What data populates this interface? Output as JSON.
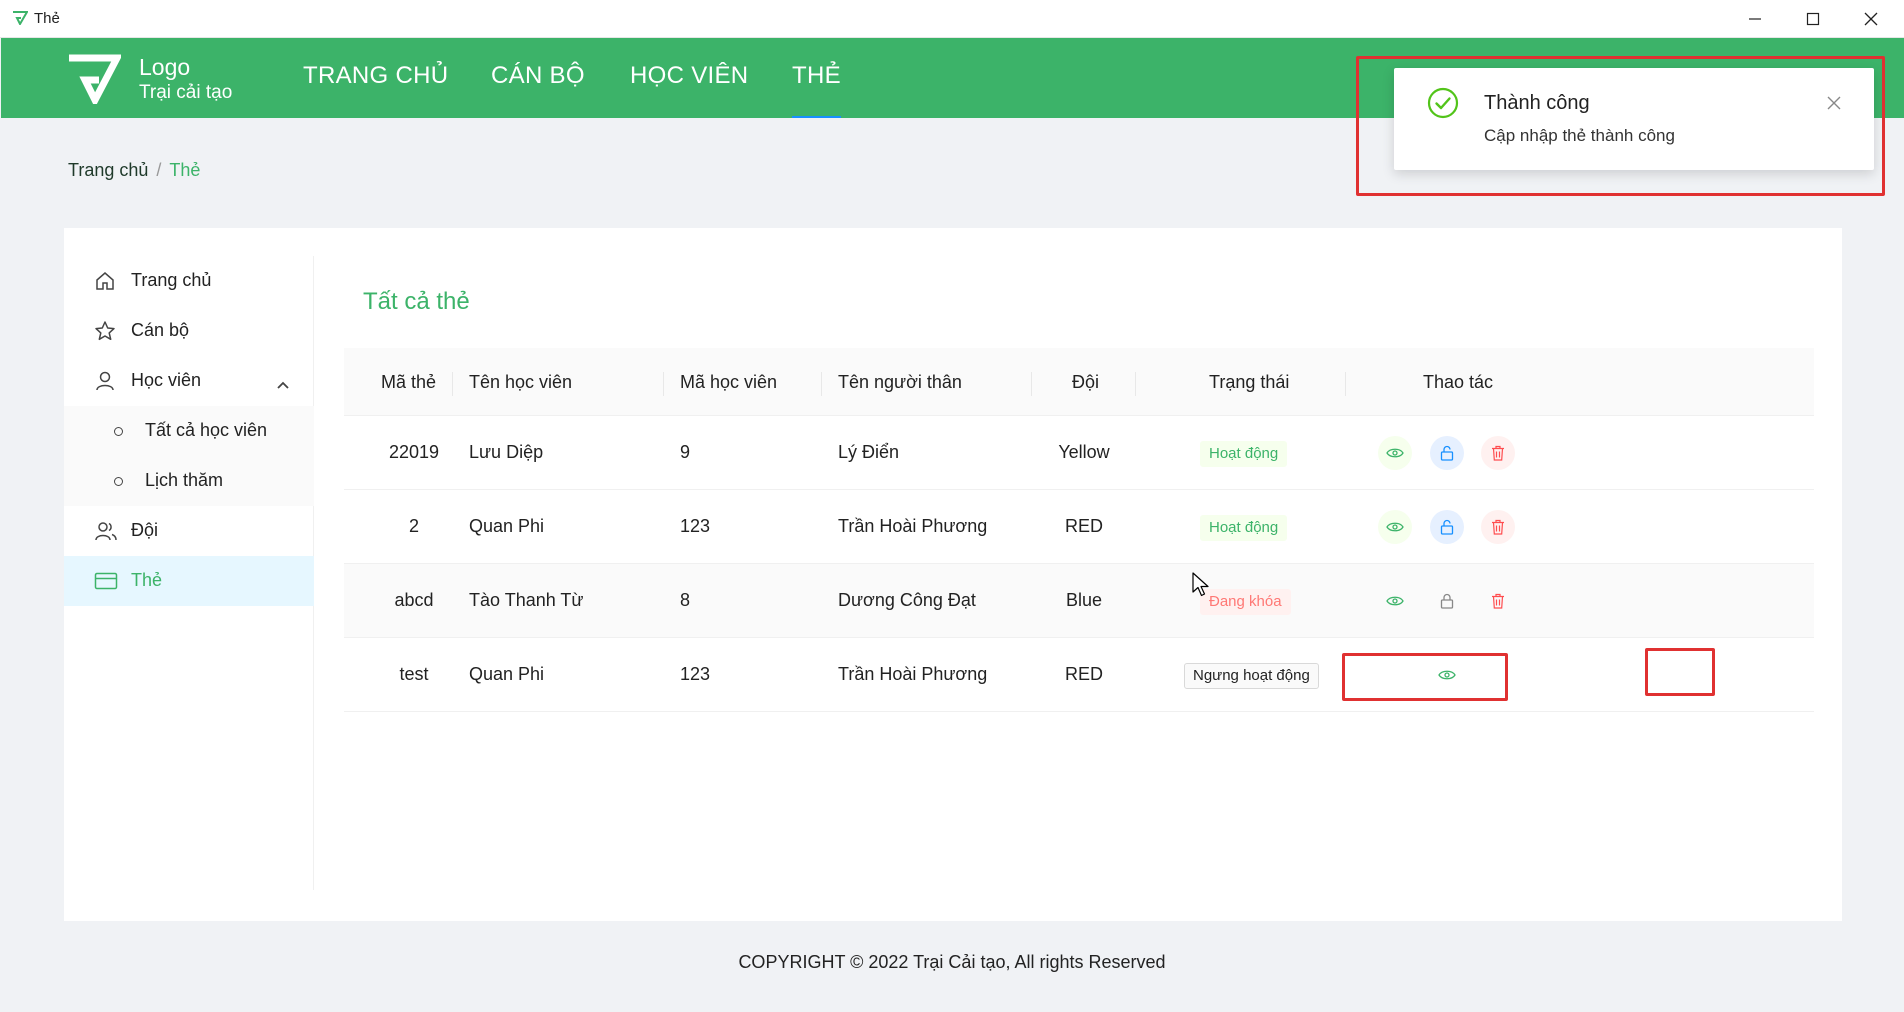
{
  "window": {
    "title": "Thẻ"
  },
  "header": {
    "logo_title": "Logo",
    "logo_subtitle": "Trại cải tạo",
    "nav": [
      "TRANG CHỦ",
      "CÁN BỘ",
      "HỌC VIÊN",
      "THẺ"
    ],
    "active_nav": "THẺ",
    "brand_color": "#3cb369"
  },
  "breadcrumb": {
    "home": "Trang chủ",
    "separator": "/",
    "current": "Thẻ"
  },
  "sidebar": {
    "items": [
      {
        "label": "Trang chủ",
        "icon": "home-icon"
      },
      {
        "label": "Cán bộ",
        "icon": "star-icon"
      },
      {
        "label": "Học viên",
        "icon": "user-icon",
        "expanded": true
      },
      {
        "label": "Đội",
        "icon": "team-icon"
      },
      {
        "label": "Thẻ",
        "icon": "card-icon",
        "active": true
      }
    ],
    "subitems": [
      "Tất cả học viên",
      "Lịch thăm"
    ]
  },
  "main": {
    "title": "Tất cả thẻ",
    "columns": [
      "Mã thẻ",
      "Tên học viên",
      "Mã học viên",
      "Tên người thân",
      "Đội",
      "Trạng thái",
      "Thao tác"
    ],
    "rows": [
      {
        "ma_the": "22019",
        "ten_hoc_vien": "Lưu Diệp",
        "ma_hoc_vien": "9",
        "ten_nguoi_than": "Lý Điển",
        "doi": "Yellow",
        "trang_thai": "Hoạt động"
      },
      {
        "ma_the": "2",
        "ten_hoc_vien": "Quan Phi",
        "ma_hoc_vien": "123",
        "ten_nguoi_than": "Trần Hoài Phương",
        "doi": "RED",
        "trang_thai": "Hoạt động"
      },
      {
        "ma_the": "abcd",
        "ten_hoc_vien": "Tào Thanh Từ",
        "ma_hoc_vien": "8",
        "ten_nguoi_than": "Dương Công Đạt",
        "doi": "Blue",
        "trang_thai": "Đang khóa"
      },
      {
        "ma_the": "test",
        "ten_hoc_vien": "Quan Phi",
        "ma_hoc_vien": "123",
        "ten_nguoi_than": "Trần Hoài Phương",
        "doi": "RED",
        "trang_thai": "Ngưng hoạt động"
      }
    ]
  },
  "footer": {
    "text": "COPYRIGHT © 2022 Trại Cải tạo, All rights Reserved"
  },
  "notification": {
    "title": "Thành công",
    "message": "Cập nhập thẻ thành công",
    "icon": "check-circle-icon"
  },
  "colors": {
    "success": "#3cb369",
    "danger": "#ff4d4f",
    "annotation": "#e03131",
    "info": "#1890ff"
  }
}
